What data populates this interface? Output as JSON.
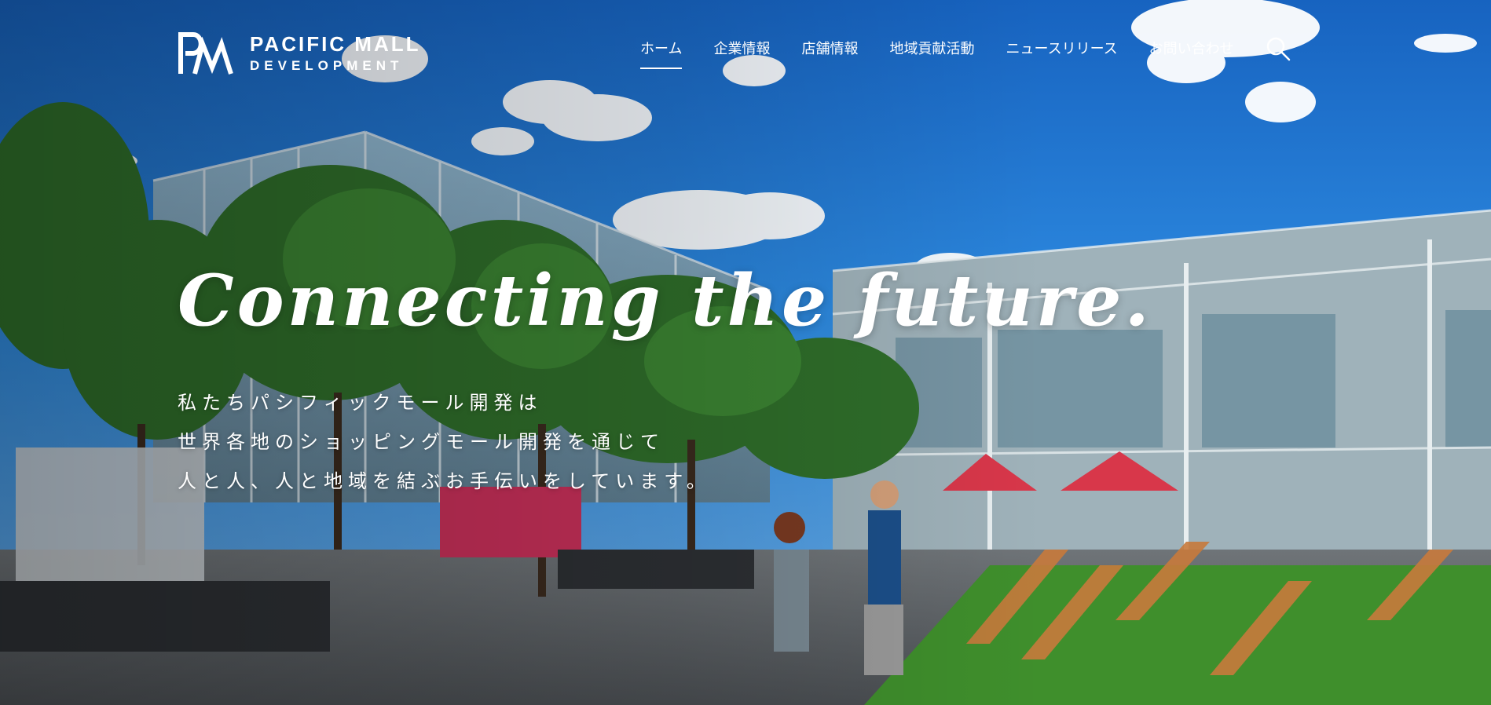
{
  "logo": {
    "line1": "PACIFIC MALL",
    "line2": "DEVELOPMENT"
  },
  "nav": {
    "items": [
      {
        "label": "ホーム",
        "active": true
      },
      {
        "label": "企業情報",
        "active": false
      },
      {
        "label": "店舗情報",
        "active": false
      },
      {
        "label": "地域貢献活動",
        "active": false
      },
      {
        "label": "ニュースリリース",
        "active": false
      },
      {
        "label": "お問い合わせ",
        "active": false
      }
    ],
    "search_icon": "search-icon"
  },
  "hero": {
    "headline": "Connecting the future.",
    "lead": [
      "私たちパシフィックモール開発は",
      "世界各地のショッピングモール開発を通じて",
      "人と人、人と地域を結ぶお手伝いをしています。"
    ]
  },
  "colors": {
    "sky": "#2a84de",
    "text": "#ffffff"
  }
}
